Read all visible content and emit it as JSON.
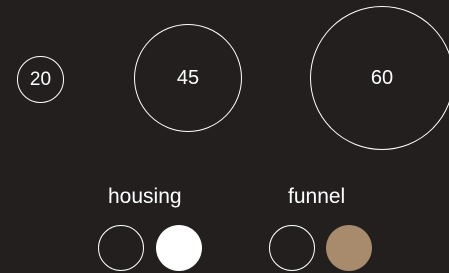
{
  "sizes": [
    {
      "label": "20"
    },
    {
      "label": "45"
    },
    {
      "label": "60"
    }
  ],
  "parts": [
    {
      "label": "housing",
      "swatches": [
        {
          "name": "dark",
          "color": "#231f1f"
        },
        {
          "name": "white",
          "color": "#ffffff"
        }
      ]
    },
    {
      "label": "funnel",
      "swatches": [
        {
          "name": "dark",
          "color": "#231f1f"
        },
        {
          "name": "tan",
          "color": "#a88b6c"
        }
      ]
    }
  ],
  "colors": {
    "background": "#231f1f",
    "foreground": "#ffffff"
  }
}
